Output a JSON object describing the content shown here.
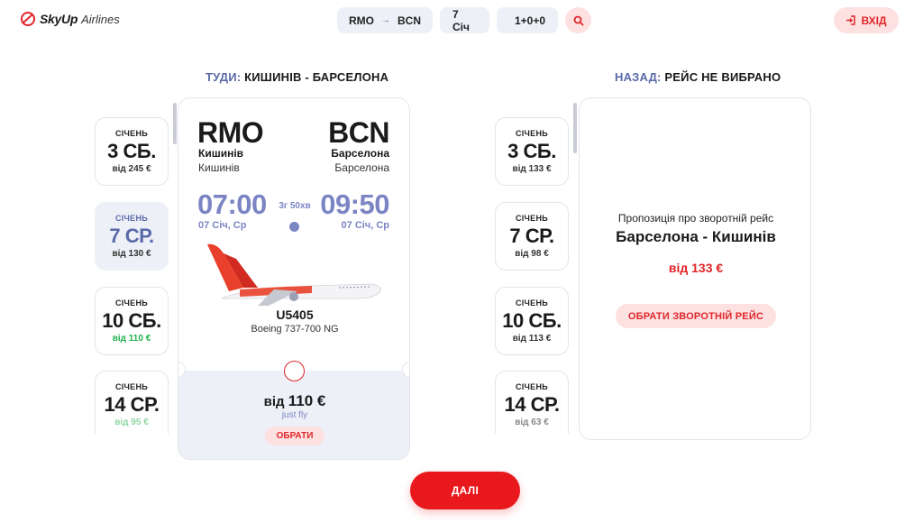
{
  "brand": {
    "name": "SkyUp",
    "suffix": "Airlines"
  },
  "search": {
    "origin": "RMO",
    "destination": "BCN",
    "arrow": "→",
    "date": "7 Січ",
    "passengers": "1+0+0"
  },
  "login": {
    "label": "ВХІД"
  },
  "outbound": {
    "title_label": "ТУДИ:",
    "title_route": "КИШИНІВ - БАРСЕЛОНА",
    "dates": [
      {
        "month": "СІЧЕНЬ",
        "day": "3 СБ.",
        "price": "від 245 €"
      },
      {
        "month": "СІЧЕНЬ",
        "day": "7 СР.",
        "price": "від 130 €"
      },
      {
        "month": "СІЧЕНЬ",
        "day": "10 СБ.",
        "price": "від 110 €"
      },
      {
        "month": "СІЧЕНЬ",
        "day": "14 СР.",
        "price": "від 95 €"
      }
    ],
    "flight": {
      "from_code": "RMO",
      "from_city_bold": "Кишинів",
      "from_city": "Кишинів",
      "to_code": "BCN",
      "to_city_bold": "Барселона",
      "to_city": "Барселона",
      "dep_time": "07:00",
      "arr_time": "09:50",
      "dep_date": "07 Січ, Ср",
      "arr_date": "07 Січ, Ср",
      "duration": "3г 50хв",
      "flight_number": "U5405",
      "aircraft": "Boeing 737-700 NG",
      "fare_prefix": "від",
      "fare_price": "110 €",
      "fare_name": "just fly",
      "choose_label": "ОБРАТИ"
    }
  },
  "inbound": {
    "title_label": "НАЗАД:",
    "title_route": "РЕЙС НЕ ВИБРАНО",
    "dates": [
      {
        "month": "СІЧЕНЬ",
        "day": "3 СБ.",
        "price": "від 133 €"
      },
      {
        "month": "СІЧЕНЬ",
        "day": "7 СР.",
        "price": "від 98 €"
      },
      {
        "month": "СІЧЕНЬ",
        "day": "10 СБ.",
        "price": "від 113 €"
      },
      {
        "month": "СІЧЕНЬ",
        "day": "14 СР.",
        "price": "від 63 €"
      }
    ],
    "offer_text": "Пропозиція про зворотній рейс",
    "offer_route": "Барселона - Кишинів",
    "offer_price": "від 133 €",
    "offer_button": "ОБРАТИ ЗВОРОТНІЙ РЕЙС"
  },
  "next_button": "ДАЛІ",
  "colors": {
    "accent": "#e8181c",
    "accent_light": "#fde1e1",
    "muted_blue": "#7b85c4",
    "panel": "#eef0f7",
    "green": "#22b04b"
  }
}
